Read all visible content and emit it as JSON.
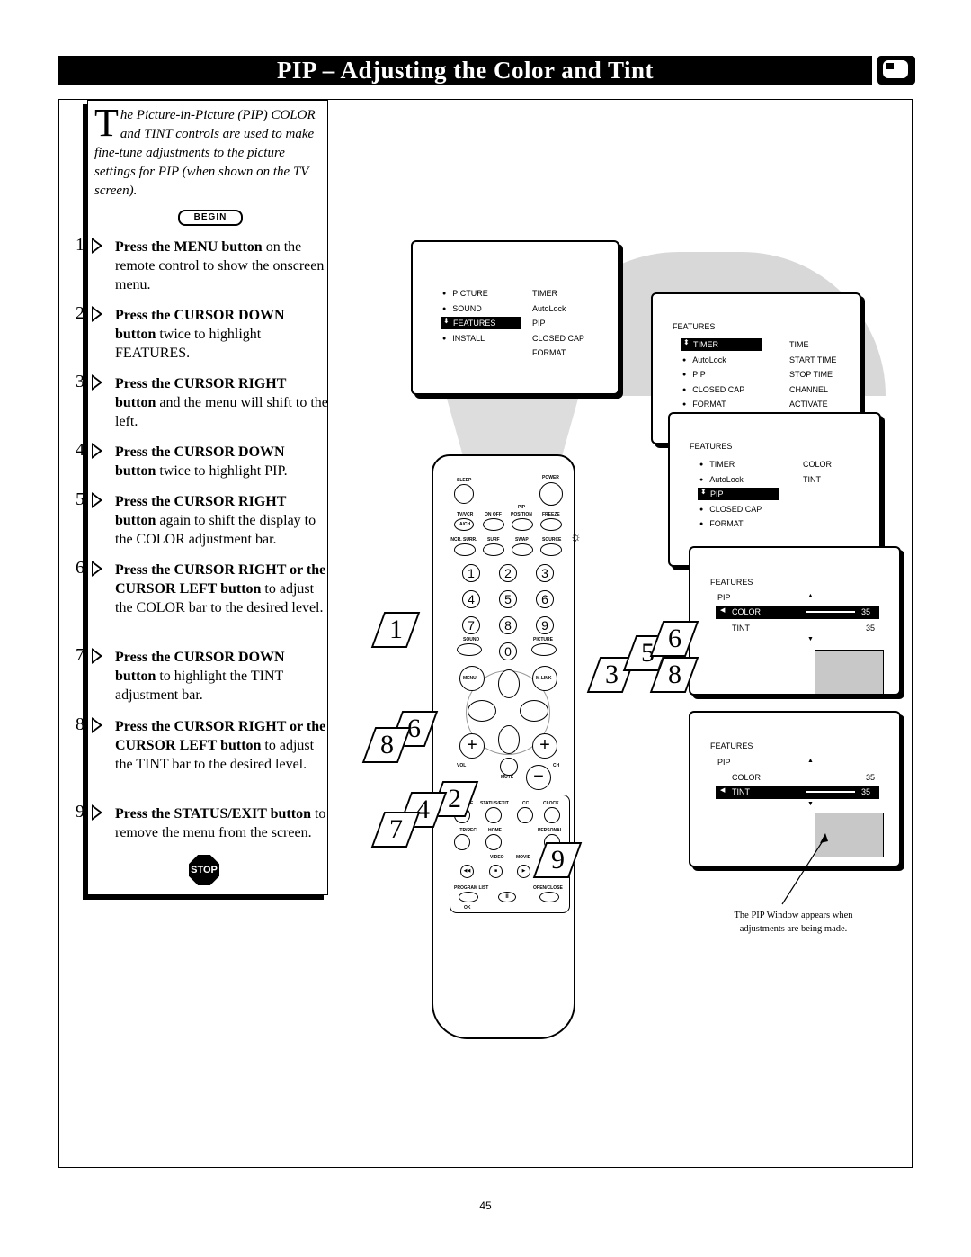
{
  "title": "PIP – Adjusting the Color and Tint",
  "intro": {
    "dropcap": "T",
    "text": "he Picture-in-Picture (PIP) COLOR and TINT controls are used to make fine-tune adjustments to the picture settings for PIP (when shown on the TV screen)."
  },
  "begin_label": "BEGIN",
  "stop_label": "STOP",
  "steps": [
    {
      "n": "1",
      "bold": "Press the MENU button",
      "rest": " on the remote control to show the onscreen menu."
    },
    {
      "n": "2",
      "bold": "Press the CURSOR DOWN button",
      "rest": " twice to highlight FEATURES."
    },
    {
      "n": "3",
      "bold": "Press the CURSOR RIGHT button",
      "rest": " and the menu will shift to the left."
    },
    {
      "n": "4",
      "bold": "Press the CURSOR DOWN button",
      "rest": " twice to highlight PIP."
    },
    {
      "n": "5",
      "bold": "Press the CURSOR RIGHT button",
      "rest": " again to shift the display to the COLOR adjustment bar."
    },
    {
      "n": "6",
      "bold": "Press the CURSOR RIGHT or the CURSOR LEFT button",
      "rest": " to adjust the COLOR bar to the desired level."
    },
    {
      "n": "7",
      "bold": "Press the CURSOR DOWN button",
      "rest": " to highlight the TINT adjustment bar."
    },
    {
      "n": "8",
      "bold": "Press the CURSOR RIGHT or the CURSOR LEFT button",
      "rest": " to adjust the TINT bar to the desired level."
    },
    {
      "n": "9",
      "bold": "Press the STATUS/EXIT button",
      "rest": " to remove the menu from the screen."
    }
  ],
  "menu1": {
    "left": [
      "PICTURE",
      "SOUND",
      "FEATURES",
      "INSTALL"
    ],
    "right": [
      "TIMER",
      "AutoLock",
      "PIP",
      "CLOSED CAP",
      "FORMAT"
    ],
    "selected": "FEATURES"
  },
  "menu2": {
    "header": "FEATURES",
    "left": [
      "TIMER",
      "AutoLock",
      "PIP",
      "CLOSED CAP",
      "FORMAT"
    ],
    "right": [
      "TIME",
      "START TIME",
      "STOP TIME",
      "CHANNEL",
      "ACTIVATE"
    ],
    "selected": "TIMER"
  },
  "menu3": {
    "header": "FEATURES",
    "left": [
      "TIMER",
      "AutoLock",
      "PIP",
      "CLOSED CAP",
      "FORMAT"
    ],
    "right": [
      "COLOR",
      "TINT"
    ],
    "selected": "PIP"
  },
  "menu4": {
    "header": "FEATURES",
    "pip": "PIP",
    "color": "COLOR",
    "color_value": "35",
    "tint": "TINT",
    "tint_value": "35",
    "selected": "COLOR",
    "level_percent": 70
  },
  "menu5": {
    "header": "FEATURES",
    "pip": "PIP",
    "color": "COLOR",
    "color_value": "35",
    "tint": "TINT",
    "tint_value": "35",
    "selected": "TINT",
    "level_percent": 70
  },
  "remote": {
    "sleep": "SLEEP",
    "power": "POWER",
    "pip": "PIP",
    "tvvcr": "TV/VCR",
    "ach": "A/CH",
    "onoff": "ON OFF",
    "position": "POSITION",
    "freeze": "FREEZE",
    "incr": "INCR. SURR.",
    "surf": "SURF",
    "swap": "SWAP",
    "source": "SOURCE",
    "digits": [
      "1",
      "2",
      "3",
      "4",
      "5",
      "6",
      "7",
      "8",
      "9",
      "0"
    ],
    "sound": "SOUND",
    "picture": "PICTURE",
    "menu": "MENU",
    "mlink": "M-LINK",
    "vol": "VOL",
    "ch": "CH",
    "mute": "MUTE",
    "source2": "SOURCE",
    "status": "STATUS/EXIT",
    "cc": "CC",
    "clock": "CLOCK",
    "itr": "ITR/REC",
    "home": "HOME",
    "personal": "PERSONAL",
    "video": "VIDEO",
    "movie": "MOVIE",
    "program": "PROGRAM LIST",
    "openclose": "OPEN/CLOSE",
    "ok": "OK"
  },
  "callouts": [
    "1",
    "2",
    "3",
    "4",
    "5",
    "6",
    "6",
    "7",
    "8",
    "8",
    "9"
  ],
  "caption": "The PIP Window appears when adjustments are being made.",
  "page_number": "45"
}
